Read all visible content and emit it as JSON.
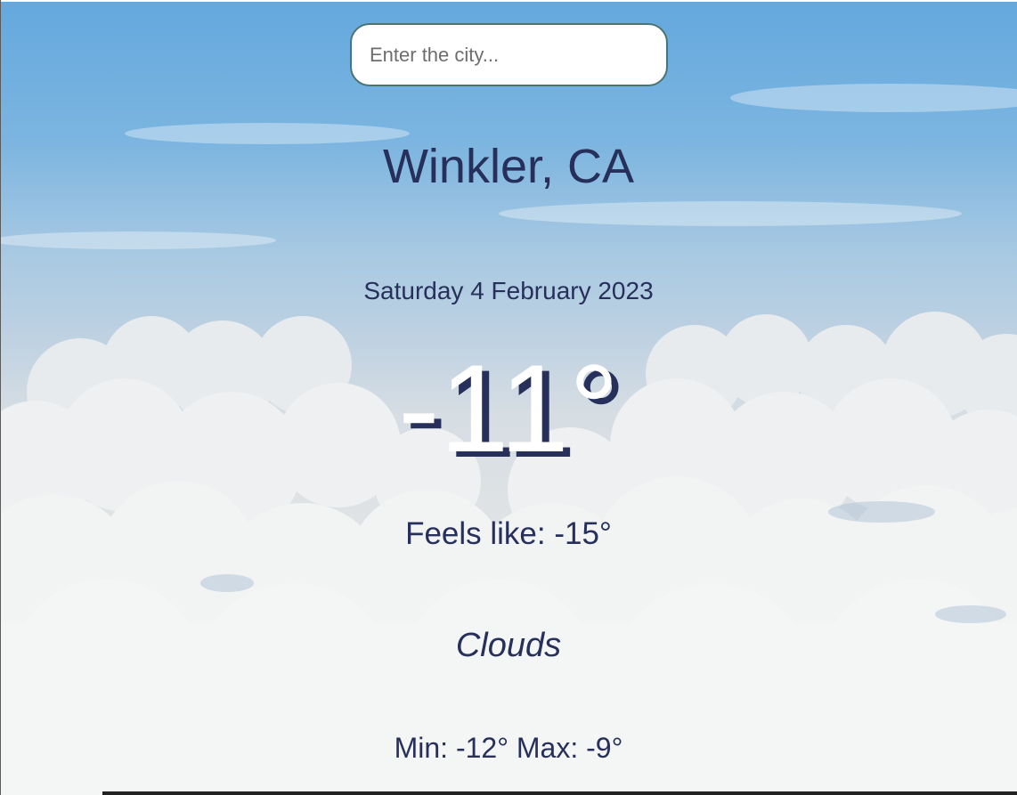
{
  "search": {
    "placeholder": "Enter the city...",
    "value": ""
  },
  "weather": {
    "location": "Winkler, CA",
    "date": "Saturday 4 February 2023",
    "temperature": "-11°",
    "feels_like": "Feels like: -15°",
    "description": "Clouds",
    "min_max": "Min: -12° Max: -9°"
  },
  "colors": {
    "text": "#26305a",
    "sky_top": "#64a8de",
    "cloud": "#eef0f0",
    "search_border": "#4a7474"
  }
}
